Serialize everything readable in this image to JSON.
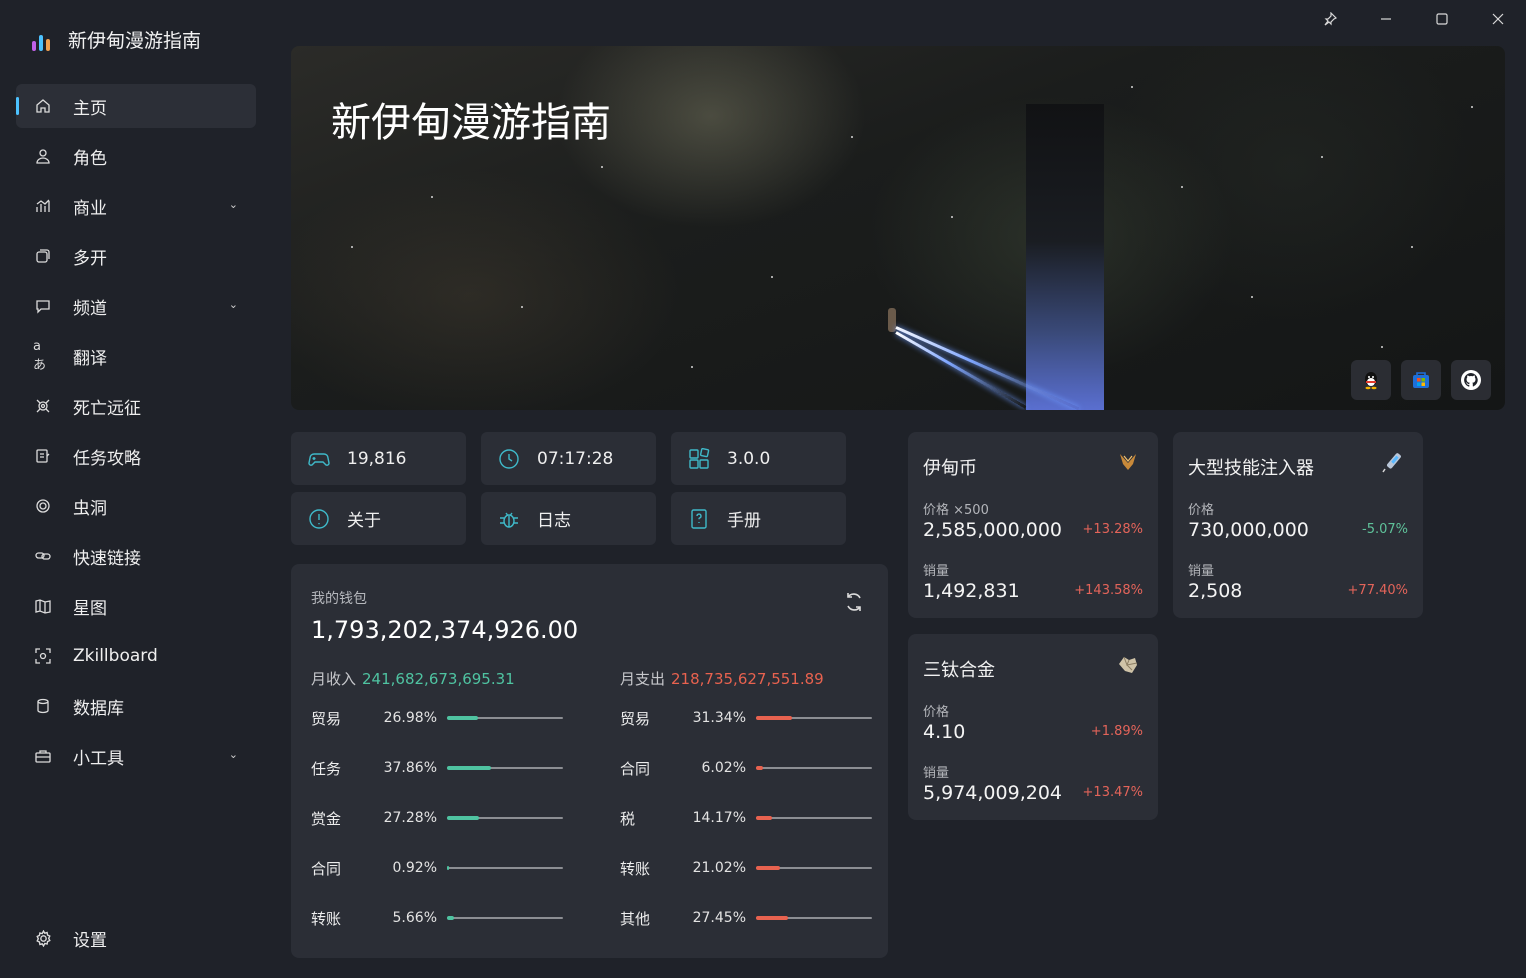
{
  "app": {
    "title": "新伊甸漫游指南"
  },
  "window": {
    "pin_icon": "pin-icon",
    "minimize_icon": "minimize-icon",
    "maximize_icon": "maximize-icon",
    "close_icon": "close-icon"
  },
  "sidebar": {
    "items": [
      {
        "label": "主页",
        "icon": "home-icon",
        "active": true
      },
      {
        "label": "角色",
        "icon": "person-icon"
      },
      {
        "label": "商业",
        "icon": "chart-icon",
        "expandable": true
      },
      {
        "label": "多开",
        "icon": "windows-icon"
      },
      {
        "label": "频道",
        "icon": "chat-icon",
        "expandable": true
      },
      {
        "label": "翻译",
        "icon": "translate-icon"
      },
      {
        "label": "死亡远征",
        "icon": "target-icon"
      },
      {
        "label": "任务攻略",
        "icon": "notes-icon"
      },
      {
        "label": "虫洞",
        "icon": "wormhole-icon"
      },
      {
        "label": "快速链接",
        "icon": "link-icon"
      },
      {
        "label": "星图",
        "icon": "map-icon"
      },
      {
        "label": "Zkillboard",
        "icon": "scan-icon"
      },
      {
        "label": "数据库",
        "icon": "database-icon"
      },
      {
        "label": "小工具",
        "icon": "toolbox-icon",
        "expandable": true
      }
    ],
    "settings": {
      "label": "设置",
      "icon": "gear-icon"
    }
  },
  "banner": {
    "title": "新伊甸漫游指南",
    "social": [
      "qq-icon",
      "store-icon",
      "github-icon"
    ]
  },
  "tiles": {
    "players": {
      "value": "19,816",
      "icon": "gamepad-icon"
    },
    "time": {
      "value": "07:17:28",
      "icon": "clock-icon"
    },
    "version": {
      "value": "3.0.0",
      "icon": "apps-icon"
    },
    "about": {
      "label": "关于",
      "icon": "info-icon"
    },
    "log": {
      "label": "日志",
      "icon": "bug-icon"
    },
    "manual": {
      "label": "手册",
      "icon": "book-icon"
    }
  },
  "wallet": {
    "caption": "我的钱包",
    "total": "1,793,202,374,926.00",
    "income": {
      "label": "月收入",
      "amount": "241,682,673,695.31",
      "color": "#4fc3a1",
      "rows": [
        {
          "label": "贸易",
          "pct": "26.98%",
          "value": 0.2698
        },
        {
          "label": "任务",
          "pct": "37.86%",
          "value": 0.3786
        },
        {
          "label": "赏金",
          "pct": "27.28%",
          "value": 0.2728
        },
        {
          "label": "合同",
          "pct": "0.92%",
          "value": 0.0092
        },
        {
          "label": "转账",
          "pct": "5.66%",
          "value": 0.0566
        }
      ]
    },
    "expense": {
      "label": "月支出",
      "amount": "218,735,627,551.89",
      "color": "#e8624f",
      "rows": [
        {
          "label": "贸易",
          "pct": "31.34%",
          "value": 0.3134
        },
        {
          "label": "合同",
          "pct": "6.02%",
          "value": 0.0602
        },
        {
          "label": "税",
          "pct": "14.17%",
          "value": 0.1417
        },
        {
          "label": "转账",
          "pct": "21.02%",
          "value": 0.2102
        },
        {
          "label": "其他",
          "pct": "27.45%",
          "value": 0.2745
        }
      ]
    }
  },
  "market": {
    "plex": {
      "title": "伊甸币",
      "icon": "plex-icon",
      "price_label": "价格 ×500",
      "price": "2,585,000,000",
      "price_change": "+13.28%",
      "volume_label": "销量",
      "volume": "1,492,831",
      "volume_change": "+143.58%"
    },
    "injector": {
      "title": "大型技能注入器",
      "icon": "injector-icon",
      "price_label": "价格",
      "price": "730,000,000",
      "price_change": "-5.07%",
      "volume_label": "销量",
      "volume": "2,508",
      "volume_change": "+77.40%"
    },
    "tritanium": {
      "title": "三钛合金",
      "icon": "tritanium-icon",
      "price_label": "价格",
      "price": "4.10",
      "price_change": "+1.89%",
      "volume_label": "销量",
      "volume": "5,974,009,204",
      "volume_change": "+13.47%"
    }
  }
}
